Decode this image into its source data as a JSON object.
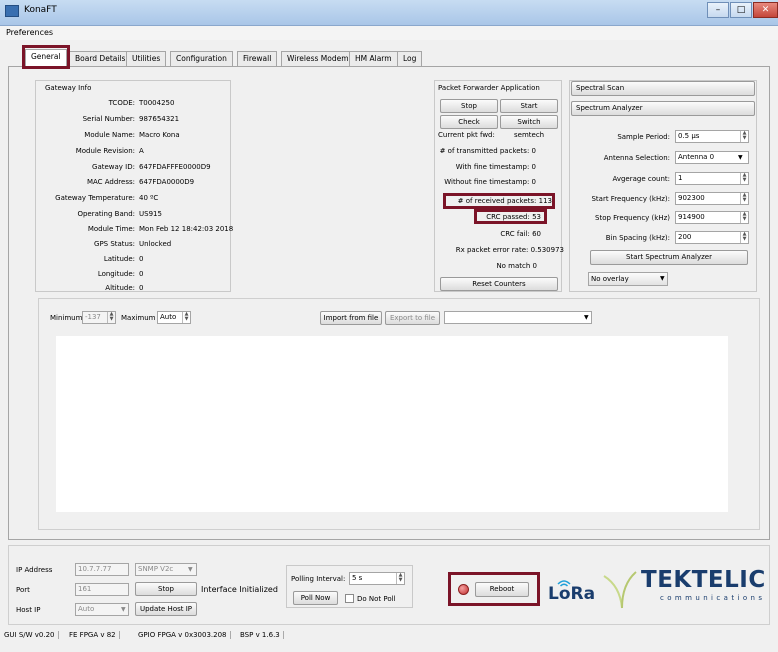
{
  "window": {
    "title": "KonaFT",
    "menu_item": "Preferences"
  },
  "tabs": [
    "General",
    "Board Details",
    "Utilities",
    "Configuration",
    "Firewall",
    "Wireless Modem",
    "HM Alarm",
    "Log"
  ],
  "gateway_info": {
    "heading": "Gateway Info",
    "rows": [
      {
        "label": "TCODE:",
        "value": "T0004250"
      },
      {
        "label": "Serial Number:",
        "value": "987654321"
      },
      {
        "label": "Module Name:",
        "value": "Macro Kona"
      },
      {
        "label": "Module Revision:",
        "value": "A"
      },
      {
        "label": "Gateway ID:",
        "value": "647FDAFFFE0000D9"
      },
      {
        "label": "MAC Address:",
        "value": "647FDA0000D9"
      },
      {
        "label": "Gateway Temperature:",
        "value": "40 ºC"
      },
      {
        "label": "Operating Band:",
        "value": "US915"
      },
      {
        "label": "Module Time:",
        "value": "Mon Feb 12 18:42:03 2018"
      },
      {
        "label": "GPS Status:",
        "value": "Unlocked"
      },
      {
        "label": "Latitude:",
        "value": "0"
      },
      {
        "label": "Longitude:",
        "value": "0"
      },
      {
        "label": "Altitude:",
        "value": "0"
      }
    ]
  },
  "packet_forwarder": {
    "heading": "Packet Forwarder Application",
    "stop": "Stop",
    "start": "Start",
    "check": "Check",
    "switch": "Switch",
    "current_label": "Current pkt fwd:",
    "current_value": "semtech",
    "transmitted": "# of transmitted packets: 0",
    "with_fine": "With fine timestamp: 0",
    "without_fine": "Without fine timestamp: 0",
    "received": "# of received packets: 113",
    "crc_passed": "CRC passed: 53",
    "crc_fail": "CRC fail: 60",
    "rx_error": "Rx packet error rate: 0.530973",
    "no_match": "No match 0",
    "reset": "Reset Counters"
  },
  "spectral": {
    "scan_header": "Spectral Scan",
    "analyzer_header": "Spectrum Analyzer",
    "sample_period_label": "Sample Period:",
    "sample_period_value": "0.5 µs",
    "antenna_label": "Antenna Selection:",
    "antenna_value": "Antenna 0",
    "avg_label": "Avgerage count:",
    "avg_value": "1",
    "start_freq_label": "Start Frequency (kHz):",
    "start_freq_value": "902300",
    "stop_freq_label": "Stop Frequency (kHz)",
    "stop_freq_value": "914900",
    "bin_label": "Bin Spacing (kHz):",
    "bin_value": "200",
    "start_button": "Start Spectrum Analyzer",
    "overlay_value": "No overlay"
  },
  "plot_controls": {
    "min_label": "Minimum",
    "min_value": "-137",
    "max_label": "Maximum",
    "max_value": "Auto",
    "import": "Import from file",
    "export": "Export to file"
  },
  "bottom": {
    "ip_label": "IP Address",
    "ip_value": "10.7.7.77",
    "protocol": "SNMP V2c",
    "port_label": "Port",
    "port_value": "161",
    "stop": "Stop",
    "status": "Interface Initialized",
    "host_label": "Host IP",
    "host_value": "Auto",
    "update_host": "Update Host IP",
    "polling_label": "Polling Interval:",
    "polling_value": "5 s",
    "poll_now": "Poll Now",
    "no_poll": "Do Not Poll",
    "reboot": "Reboot",
    "lora": "LoRa",
    "brand": "TEKTELIC",
    "brand_sub": "communications"
  },
  "statusbar": [
    "GUI S/W v0.20",
    "FE FPGA v 82",
    "GPIO FPGA v 0x3003.208",
    "BSP v 1.6.3"
  ],
  "colors": {
    "highlight": "#7b1428",
    "led": "#d64545"
  }
}
